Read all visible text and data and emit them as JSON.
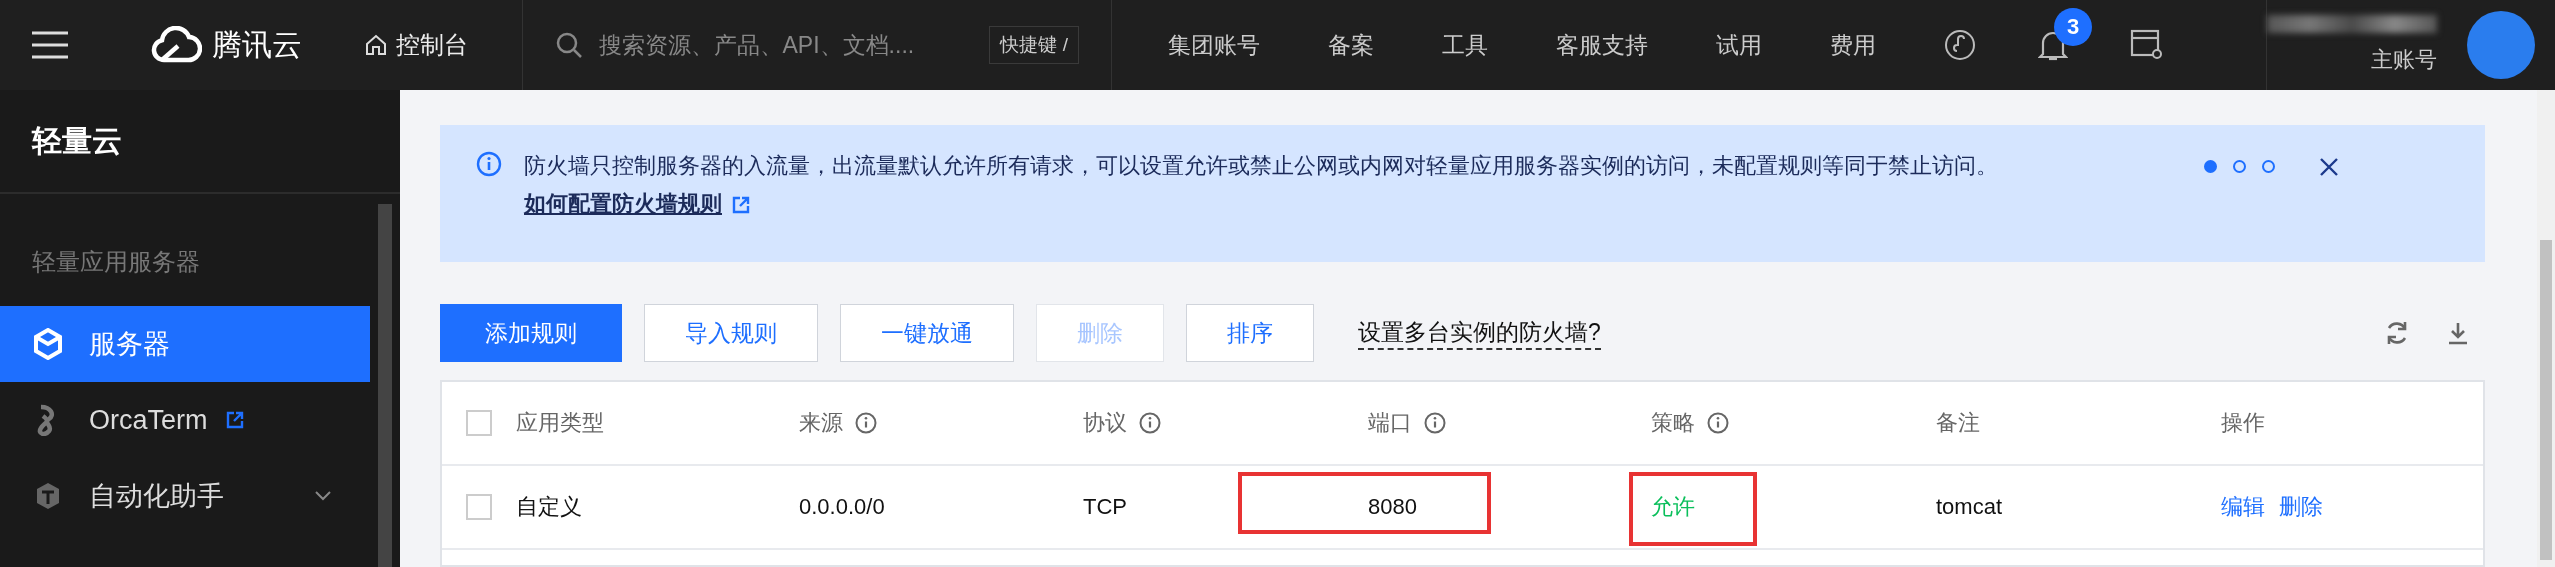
{
  "top_bar": {
    "brand": "腾讯云",
    "console": "控制台",
    "search": {
      "placeholder": "搜索资源、产品、API、文档...."
    },
    "shortcut": "快捷键 /",
    "nav": [
      "集团账号",
      "备案",
      "工具",
      "客服支持",
      "试用",
      "费用"
    ],
    "notifications": {
      "count": "3"
    },
    "account": {
      "role": "主账号"
    }
  },
  "sidebar": {
    "title": "轻量云",
    "section": "轻量应用服务器",
    "items": [
      {
        "label": "服务器",
        "kind": "link",
        "selected": true
      },
      {
        "label": "OrcaTerm",
        "kind": "external",
        "selected": false
      },
      {
        "label": "自动化助手",
        "kind": "group",
        "selected": false,
        "expanded": false
      }
    ]
  },
  "banner": {
    "text": "防火墙只控制服务器的入流量，出流量默认允许所有请求，可以设置允许或禁止公网或内网对轻量应用服务器实例的访问，未配置规则等同于禁止访问。",
    "link": "如何配置防火墙规则",
    "pages": [
      {
        "selected": true
      },
      {
        "selected": false
      },
      {
        "selected": false
      }
    ]
  },
  "toolbar": {
    "buttons": [
      {
        "label": "添加规则",
        "kind": "primary",
        "disabled": false
      },
      {
        "label": "导入规则",
        "kind": "default",
        "disabled": false
      },
      {
        "label": "一键放通",
        "kind": "default",
        "disabled": false
      },
      {
        "label": "删除",
        "kind": "default",
        "disabled": true
      },
      {
        "label": "排序",
        "kind": "default",
        "disabled": false
      }
    ],
    "help_link": "设置多台实例的防火墙?"
  },
  "table": {
    "header_checked": false,
    "columns": [
      {
        "label": "应用类型",
        "kind": "plain"
      },
      {
        "label": "来源",
        "kind": "info"
      },
      {
        "label": "协议",
        "kind": "info"
      },
      {
        "label": "端口",
        "kind": "info"
      },
      {
        "label": "策略",
        "kind": "info"
      },
      {
        "label": "备注",
        "kind": "plain"
      },
      {
        "label": "操作",
        "kind": "plain"
      }
    ],
    "rows": [
      {
        "checked": false,
        "cells": [
          {
            "text": "自定义",
            "kind": "text",
            "highlighted": false
          },
          {
            "text": "0.0.0.0/0",
            "kind": "text",
            "highlighted": false
          },
          {
            "text": "TCP",
            "kind": "text",
            "highlighted": false
          },
          {
            "text": "8080",
            "kind": "text",
            "highlighted": true
          },
          {
            "text": "允许",
            "kind": "allow",
            "highlighted": true
          },
          {
            "text": "tomcat",
            "kind": "text",
            "highlighted": false
          }
        ],
        "actions": [
          "编辑",
          "删除"
        ]
      }
    ]
  }
}
